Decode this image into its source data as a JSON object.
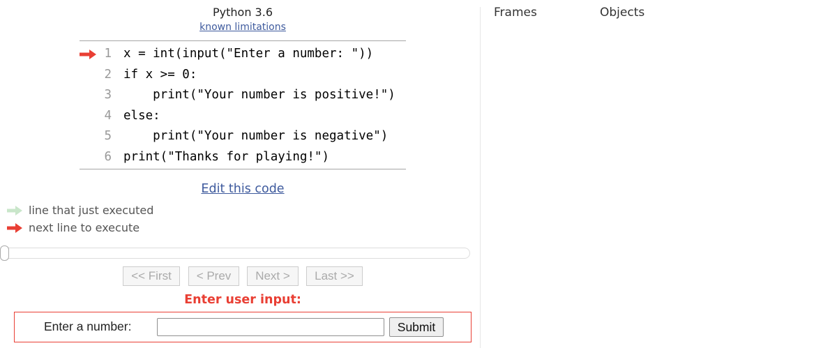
{
  "header": {
    "language": "Python 3.6",
    "limitations_link": "known limitations"
  },
  "code": {
    "lines": [
      {
        "number": "1",
        "text": "x = int(input(\"Enter a number: \"))"
      },
      {
        "number": "2",
        "text": "if x >= 0:"
      },
      {
        "number": "3",
        "text": "    print(\"Your number is positive!\")"
      },
      {
        "number": "4",
        "text": "else:"
      },
      {
        "number": "5",
        "text": "    print(\"Your number is negative\")"
      },
      {
        "number": "6",
        "text": "print(\"Thanks for playing!\")"
      }
    ],
    "current_line": 1
  },
  "edit_link": "Edit this code",
  "legend": {
    "executed_label": "line that just executed",
    "next_label": "next line to execute",
    "executed_color": "#c9e6ca",
    "next_color": "#e93f34"
  },
  "slider": {
    "position": 0
  },
  "navigation": {
    "first": "<< First",
    "prev": "< Prev",
    "next": "Next >",
    "last": "Last >>"
  },
  "user_input": {
    "prompt": "Enter user input:",
    "label": "Enter a number:",
    "value": "",
    "submit": "Submit"
  },
  "visualization": {
    "frames_label": "Frames",
    "objects_label": "Objects"
  }
}
